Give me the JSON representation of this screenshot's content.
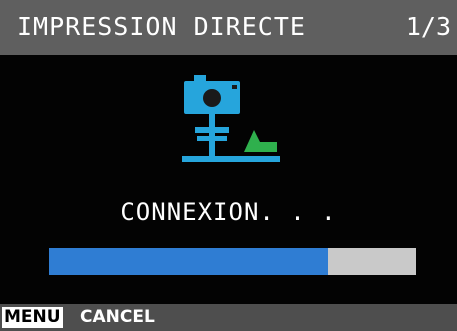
{
  "header": {
    "title": "IMPRESSION DIRECTE",
    "page_indicator": "1/3"
  },
  "status": {
    "message": "CONNEXION. . .",
    "progress": 0.76
  },
  "footer": {
    "menu_key": "MENU",
    "cancel_label": "CANCEL"
  },
  "icons": {
    "main": "camera-printer-connection-icon"
  },
  "colors": {
    "background": "#030303",
    "title_bar": "#5f5f5f",
    "icon_blue": "#26a5dc",
    "icon_green": "#2fb04d",
    "progress_fill": "#2f7dd3",
    "progress_track": "#c9c9c9"
  }
}
